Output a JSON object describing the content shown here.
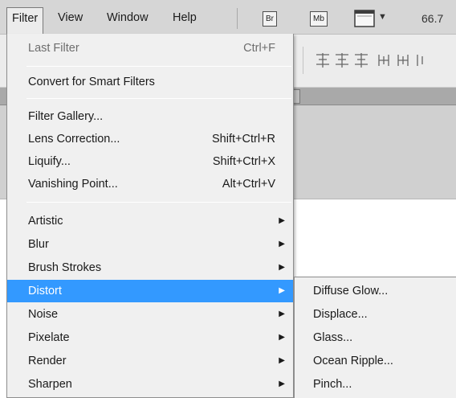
{
  "menubar": {
    "items": [
      "Filter",
      "View",
      "Window",
      "Help"
    ],
    "bridge_badge": "Br",
    "minibridge_badge": "Mb",
    "zoom": "66.7"
  },
  "filter_menu": {
    "last_filter": {
      "label": "Last Filter",
      "shortcut": "Ctrl+F",
      "enabled": false
    },
    "convert_smart": "Convert for Smart Filters",
    "group_special": [
      {
        "label": "Filter Gallery...",
        "shortcut": ""
      },
      {
        "label": "Lens Correction...",
        "shortcut": "Shift+Ctrl+R"
      },
      {
        "label": "Liquify...",
        "shortcut": "Shift+Ctrl+X"
      },
      {
        "label": "Vanishing Point...",
        "shortcut": "Alt+Ctrl+V"
      }
    ],
    "submenus": [
      "Artistic",
      "Blur",
      "Brush Strokes",
      "Distort",
      "Noise",
      "Pixelate",
      "Render",
      "Sharpen"
    ],
    "highlighted": "Distort"
  },
  "distort_submenu": {
    "items": [
      "Diffuse Glow...",
      "Displace...",
      "Glass...",
      "Ocean Ripple...",
      "Pinch..."
    ]
  },
  "colors": {
    "highlight": "#3399ff",
    "menu_bg": "#f0f0f0",
    "menubar_bg": "#d6d6d6"
  }
}
